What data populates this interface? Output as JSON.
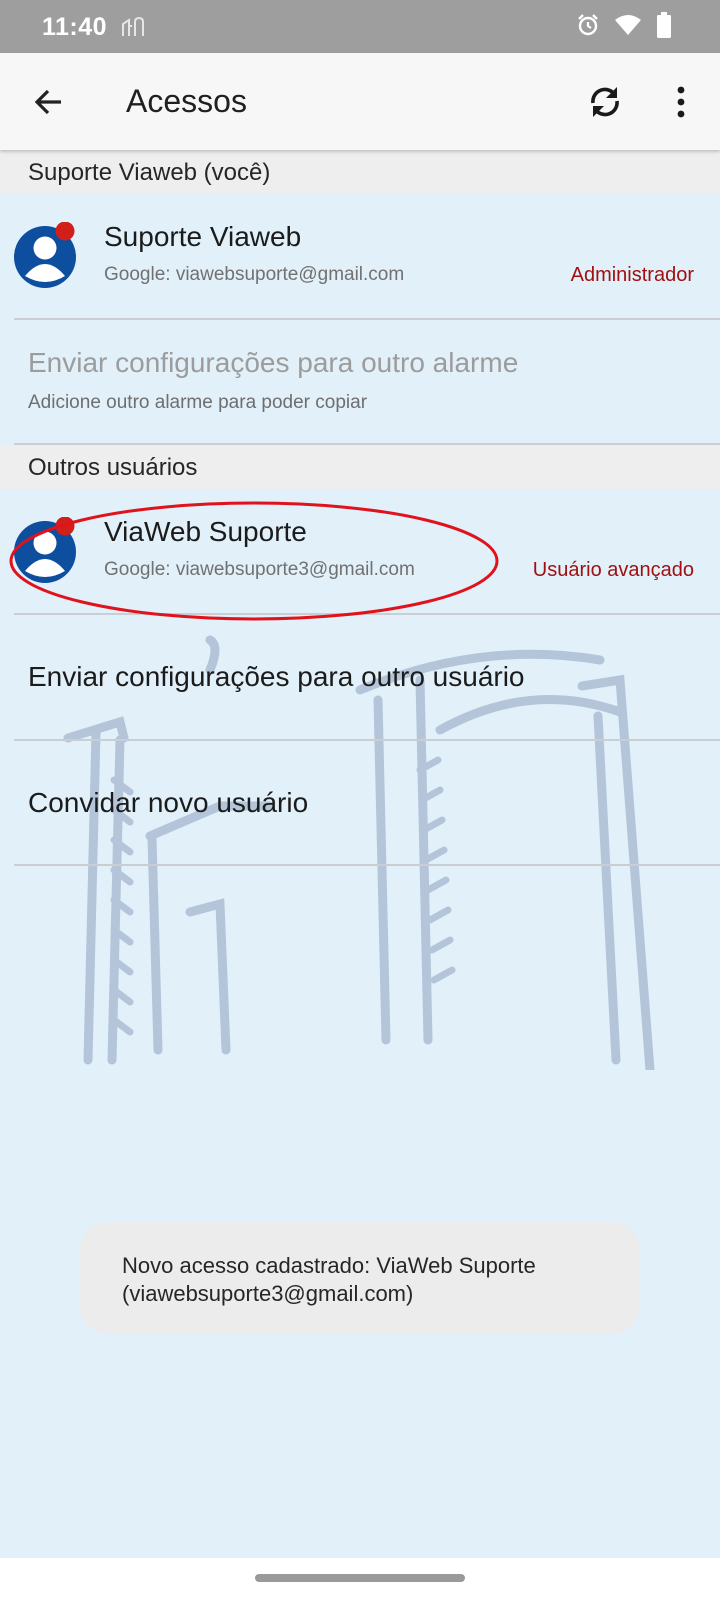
{
  "status_bar": {
    "time": "11:40",
    "notification_icon": "notification-icon",
    "icons": [
      "alarm-icon",
      "wifi-icon",
      "battery-icon"
    ]
  },
  "app_bar": {
    "title": "Acessos",
    "back_icon": "back-arrow-icon",
    "sync_icon": "sync-icon",
    "more_icon": "more-vert-icon"
  },
  "sections": {
    "you": {
      "header": "Suporte Viaweb (você)",
      "user": {
        "name": "Suporte Viaweb",
        "email": "Google: viawebsuporte@gmail.com",
        "role": "Administrador"
      },
      "send_to_alarm": {
        "title": "Enviar configurações para outro alarme",
        "subtitle": "Adicione outro alarme para poder copiar"
      }
    },
    "others": {
      "header": "Outros usuários",
      "user": {
        "name": "ViaWeb Suporte",
        "email": "Google: viawebsuporte3@gmail.com",
        "role": "Usuário avançado"
      },
      "send_to_user": "Enviar configurações para outro usuário",
      "invite": "Convidar novo usuário"
    }
  },
  "snackbar": {
    "message": "Novo acesso cadastrado: ViaWeb Suporte (viawebsuporte3@gmail.com)"
  },
  "colors": {
    "accent": "#0d4f9e",
    "badge": "#d21f1a",
    "role_text": "#a01010",
    "highlight": "#e0121c",
    "content_bg": "#e1f0f9"
  }
}
